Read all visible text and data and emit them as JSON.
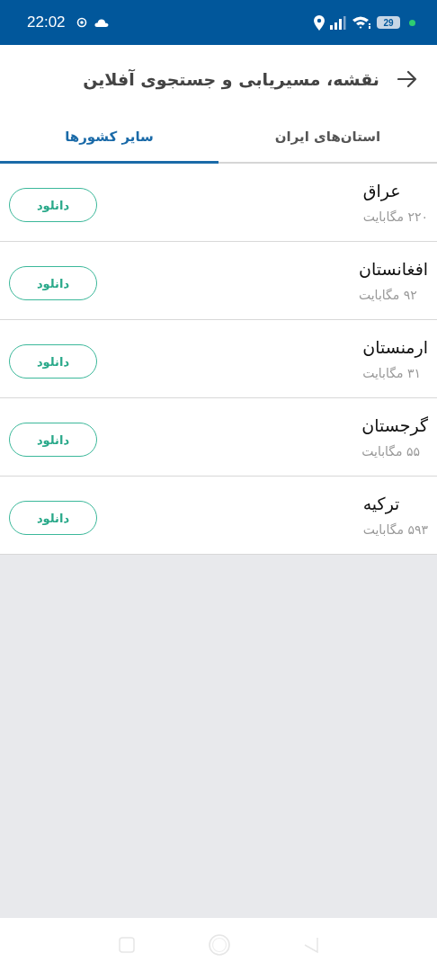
{
  "status_bar": {
    "time": "22:02",
    "battery": "29"
  },
  "header": {
    "title": "نقشه، مسیریابی و جستجوی آفلاین"
  },
  "tabs": [
    {
      "label": "استان‌های ایران",
      "selected": false
    },
    {
      "label": "سایر کشورها",
      "selected": true
    }
  ],
  "countries": [
    {
      "name": "عراق",
      "size": "۲۲۰ مگابایت",
      "button": "دانلود"
    },
    {
      "name": "افغانستان",
      "size": "۹۲ مگابایت",
      "button": "دانلود"
    },
    {
      "name": "ارمنستان",
      "size": "۳۱ مگابایت",
      "button": "دانلود"
    },
    {
      "name": "گرجستان",
      "size": "۵۵ مگابایت",
      "button": "دانلود"
    },
    {
      "name": "ترکیه",
      "size": "۵۹۳ مگابایت",
      "button": "دانلود"
    }
  ]
}
